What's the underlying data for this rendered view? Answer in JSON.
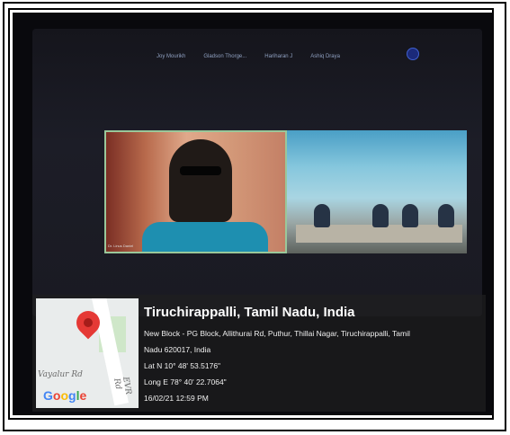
{
  "meeting": {
    "participants": [
      "Joy Mourikh",
      "Gladson Thorge...",
      "Hariharan J",
      "Ashiq Draya"
    ]
  },
  "video_caption": "Dr. Linus Daniel",
  "geotag": {
    "title": "Tiruchirappalli, Tamil Nadu, India",
    "address_line1": "New Block - PG Block, Allithurai Rd, Puthur, Thillai Nagar, Tiruchirappalli, Tamil",
    "address_line2": "Nadu 620017, India",
    "latitude": "Lat N 10° 48' 53.5176\"",
    "longitude": "Long E 78° 40' 22.7064\"",
    "datetime": "16/02/21 12:59 PM",
    "map": {
      "label1": "Vayalur Rd",
      "label2": "EVR Rd",
      "logo": "Google",
      "pin_color": "#e53935"
    }
  }
}
